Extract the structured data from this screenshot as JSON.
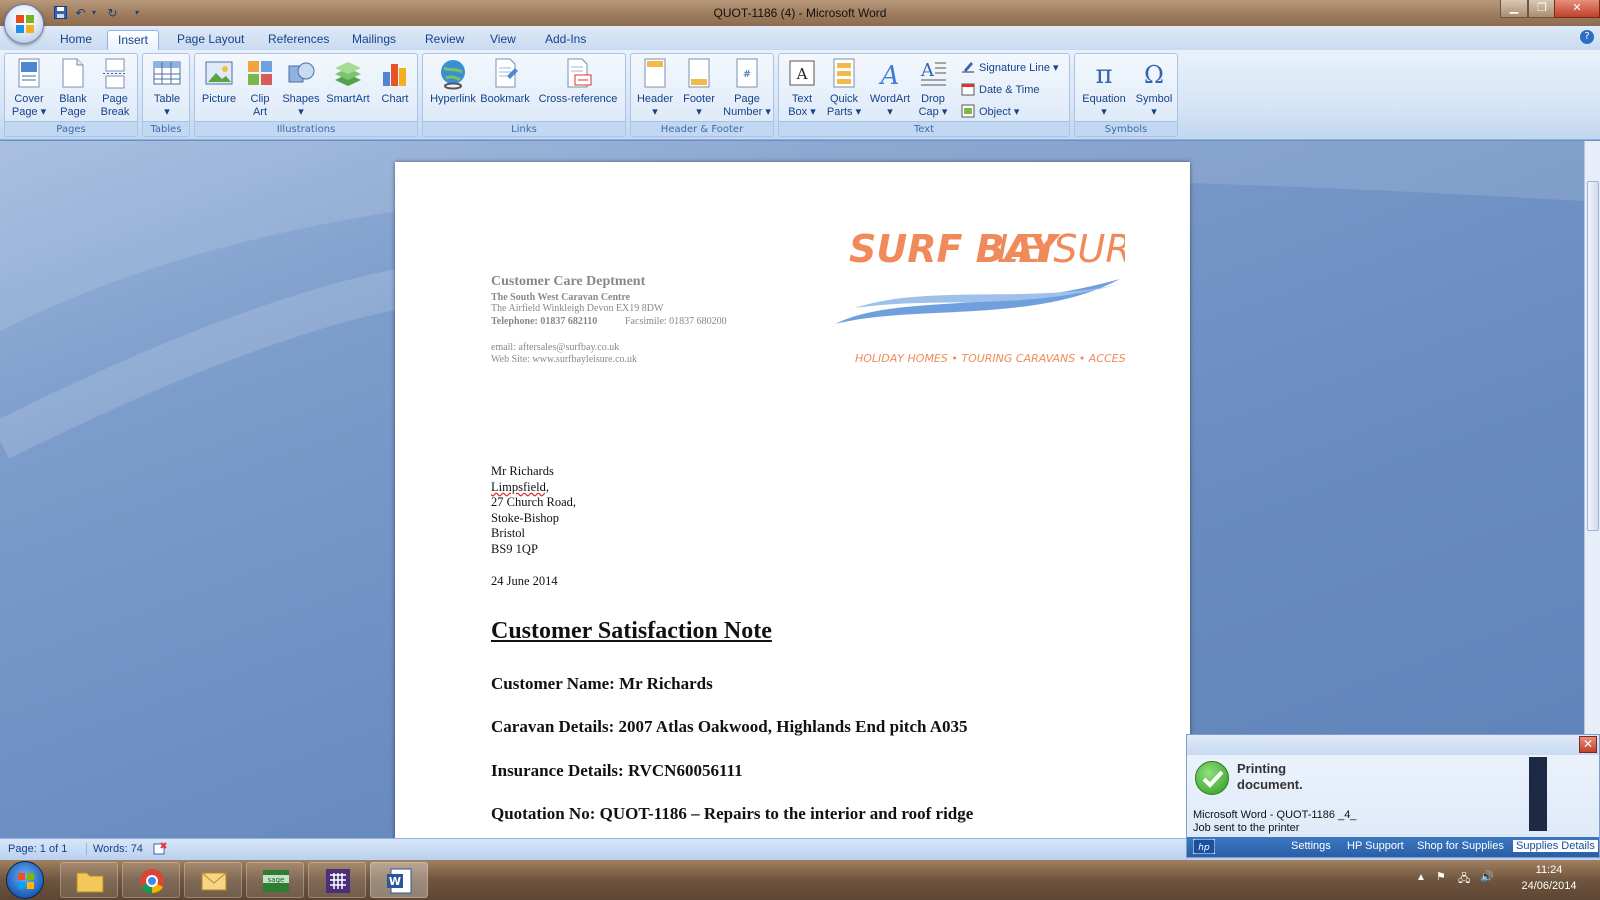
{
  "window": {
    "title": "QUOT-1186 (4) - Microsoft Word"
  },
  "ribbon_tabs": [
    "Home",
    "Insert",
    "Page Layout",
    "References",
    "Mailings",
    "Review",
    "View",
    "Add-Ins"
  ],
  "active_tab": "Insert",
  "ribbon": {
    "pages": {
      "label": "Pages",
      "cover_page": "Cover Page",
      "blank_page": "Blank Page",
      "page_break": "Page Break"
    },
    "tables": {
      "label": "Tables",
      "table": "Table"
    },
    "illustrations": {
      "label": "Illustrations",
      "picture": "Picture",
      "clip_art": "Clip Art",
      "shapes": "Shapes",
      "smartart": "SmartArt",
      "chart": "Chart"
    },
    "links": {
      "label": "Links",
      "hyperlink": "Hyperlink",
      "bookmark": "Bookmark",
      "cross_reference": "Cross-reference"
    },
    "header_footer": {
      "label": "Header & Footer",
      "header": "Header",
      "footer": "Footer",
      "page_number": "Page Number"
    },
    "text": {
      "label": "Text",
      "text_box": "Text Box",
      "quick_parts": "Quick Parts",
      "wordart": "WordArt",
      "drop_cap": "Drop Cap",
      "signature_line": "Signature Line",
      "date_time": "Date & Time",
      "object": "Object"
    },
    "symbols": {
      "label": "Symbols",
      "equation": "Equation",
      "symbol": "Symbol"
    }
  },
  "document": {
    "dept": "Customer Care Deptment",
    "company": "The South West Caravan Centre",
    "address": "The Airfield Winkleigh Devon EX19 8DW",
    "telephone_label": "Telephone: 01837 682110",
    "facsimile": "Facsimile: 01837 680200",
    "email": "email: aftersales@surfbay.co.uk",
    "website": "Web Site: www.surfbayleisure.co.uk",
    "logo": {
      "name_bold": "SURF BAY",
      "name_light": "LEISURE",
      "tagline": "HOLIDAY HOMES • TOURING CARAVANS • ACCESSORIES"
    },
    "recipient": [
      "Mr Richards",
      "Limpsfield,",
      "27 Church Road,",
      "Stoke-Bishop",
      "Bristol",
      "BS9 1QP"
    ],
    "date": "24 June 2014",
    "heading": "Customer Satisfaction Note",
    "customer_name": "Customer Name:  Mr Richards",
    "caravan_details": "Caravan Details:  2007  Atlas Oakwood, Highlands End pitch A035",
    "insurance_details": "Insurance Details: RVCN60056111",
    "quotation": "Quotation No: QUOT-1186 – Repairs to the interior and roof ridge"
  },
  "status_bar": {
    "page": "Page: 1 of 1",
    "words": "Words: 74"
  },
  "toast": {
    "heading_line1": "Printing",
    "heading_line2": "document.",
    "job_line": "Microsoft Word - QUOT-1186 _4_",
    "sent_line": "Job sent to the printer",
    "links": [
      "Settings",
      "HP Support",
      "Shop for Supplies",
      "Supplies Details"
    ]
  },
  "taskbar": {
    "time": "11:24",
    "date": "24/06/2014"
  },
  "colors": {
    "ribbon_text": "#15428b",
    "logo_orange": "#f08a5b",
    "logo_blue": "#6f9fdc"
  }
}
